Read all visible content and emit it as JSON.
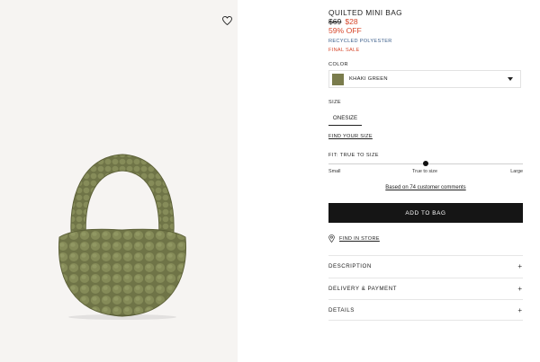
{
  "product": {
    "title": "QUILTED MINI BAG",
    "old_price": "$69",
    "new_price": "$28",
    "discount": "59% OFF",
    "material": "RECYCLED POLYESTER",
    "sale_note": "FINAL SALE"
  },
  "color": {
    "label": "COLOR",
    "selected": "KHAKI GREEN",
    "swatch": "#7a7c4c"
  },
  "size": {
    "label": "SIZE",
    "option": "ONESIZE",
    "find_link": "FIND YOUR SIZE"
  },
  "fit": {
    "label": "FIT: TRUE TO SIZE",
    "scale_small": "Small",
    "scale_true": "True to size",
    "scale_large": "Large",
    "position": 0.5
  },
  "reviews": {
    "text": "Based on 74 customer comments"
  },
  "actions": {
    "add_to_bag": "ADD TO BAG",
    "find_in_store": "FIND IN STORE"
  },
  "accordion": [
    {
      "title": "DESCRIPTION",
      "icon": "+"
    },
    {
      "title": "DELIVERY & PAYMENT",
      "icon": "+"
    },
    {
      "title": "DETAILS",
      "icon": "+"
    }
  ],
  "colors": {
    "accent_sale": "#d6472b",
    "material_link": "#3a5d8a",
    "button_bg": "#151515",
    "gallery_bg": "#f6f4f2"
  },
  "icons": {
    "wishlist": "heart-icon",
    "dropdown": "chevron-down-icon",
    "store": "location-pin-icon"
  }
}
